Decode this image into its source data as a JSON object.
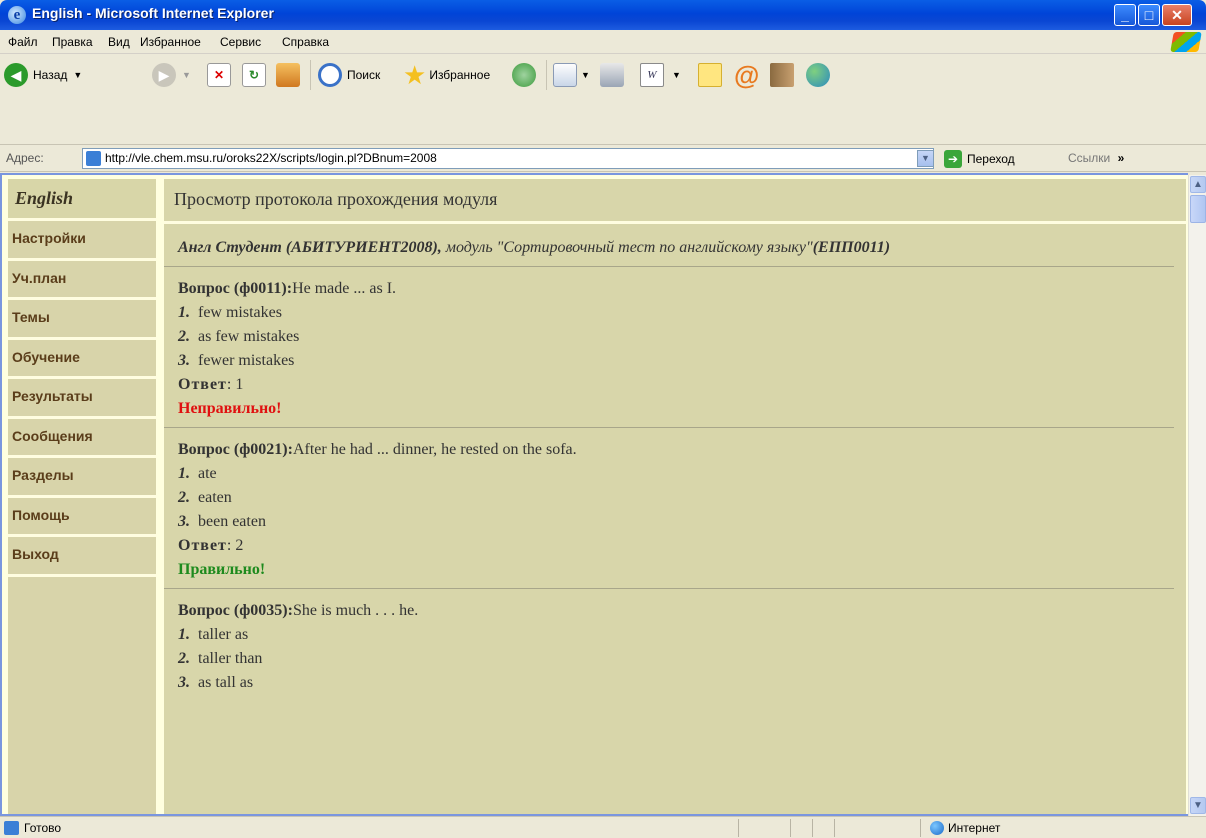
{
  "window": {
    "title": "English - Microsoft Internet Explorer"
  },
  "menu": [
    "Файл",
    "Правка",
    "Вид",
    "Избранное",
    "Сервис",
    "Справка"
  ],
  "toolbar": {
    "back": "Назад",
    "search": "Поиск",
    "favorites": "Избранное"
  },
  "address": {
    "label": "Адрес:",
    "url": "http://vle.chem.msu.ru/oroks22X/scripts/login.pl?DBnum=2008",
    "go": "Переход",
    "links": "Ссылки"
  },
  "sidebar": {
    "title": "English",
    "items": [
      "Настройки",
      "Уч.план",
      "Темы",
      "Обучение",
      "Результаты",
      "Сообщения",
      "Разделы",
      "Помощь",
      "Выход"
    ]
  },
  "main": {
    "heading": "Просмотр протокола прохождения модуля",
    "student_name": "Англ Студент (АБИТУРИЕНТ2008),",
    "module_text": " модуль \"Сортировочный тест по английскому языку\"",
    "module_code": "(ЕПП0011)",
    "question_label": "Вопрос",
    "answer_label": "Ответ",
    "questions": [
      {
        "id": "(ф0011):",
        "text": "He made ... as I.",
        "options": [
          "few mistakes",
          "as few mistakes",
          "fewer mistakes"
        ],
        "answer": "1",
        "verdict": "Неправильно!",
        "correct": false
      },
      {
        "id": "(ф0021):",
        "text": "After he had ... dinner, he rested on the sofa.",
        "options": [
          "ate",
          "eaten",
          "been eaten"
        ],
        "answer": "2",
        "verdict": "Правильно!",
        "correct": true
      },
      {
        "id": "(ф0035):",
        "text": "She is much . . . he.",
        "options": [
          "taller as",
          "taller than",
          "as tall as"
        ],
        "answer": "",
        "verdict": "",
        "correct": null
      }
    ]
  },
  "status": {
    "text": "Готово",
    "zone": "Интернет"
  }
}
